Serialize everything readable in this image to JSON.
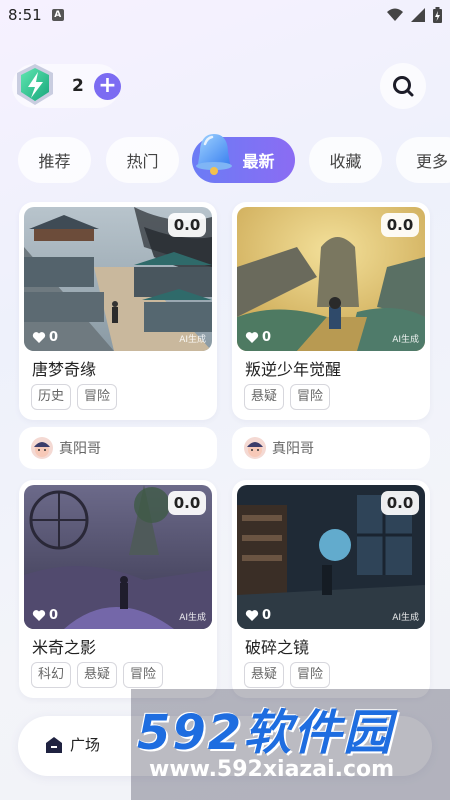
{
  "status_bar": {
    "time": "8:51",
    "notif_letter": "A"
  },
  "top": {
    "energy_count": "2",
    "plus_label": "+"
  },
  "tabs": [
    {
      "label": "推荐"
    },
    {
      "label": "热门"
    },
    {
      "label": "最新",
      "active": true
    },
    {
      "label": "收藏"
    },
    {
      "label": "更多"
    }
  ],
  "cards": [
    {
      "score": "0.0",
      "likes": "0",
      "ai_label": "AI生成",
      "title": "唐梦奇缘",
      "tags": [
        "历史",
        "冒险"
      ],
      "author": "真阳哥"
    },
    {
      "score": "0.0",
      "likes": "0",
      "ai_label": "AI生成",
      "title": "叛逆少年觉醒",
      "tags": [
        "悬疑",
        "冒险"
      ],
      "author": "真阳哥"
    },
    {
      "score": "0.0",
      "likes": "0",
      "ai_label": "AI生成",
      "title": "米奇之影",
      "tags": [
        "科幻",
        "悬疑",
        "冒险"
      ]
    },
    {
      "score": "0.0",
      "likes": "0",
      "ai_label": "AI生成",
      "title": "破碎之镜",
      "tags": [
        "悬疑",
        "冒险"
      ]
    }
  ],
  "bottom_nav": {
    "home_label": "广场"
  },
  "watermark": {
    "big": "592软件园",
    "small": "www.592xiazai.com"
  },
  "colors": {
    "accent": "#7c6cf2",
    "tab_active_start": "#6b7cf5",
    "tab_active_end": "#8b6cf3"
  }
}
